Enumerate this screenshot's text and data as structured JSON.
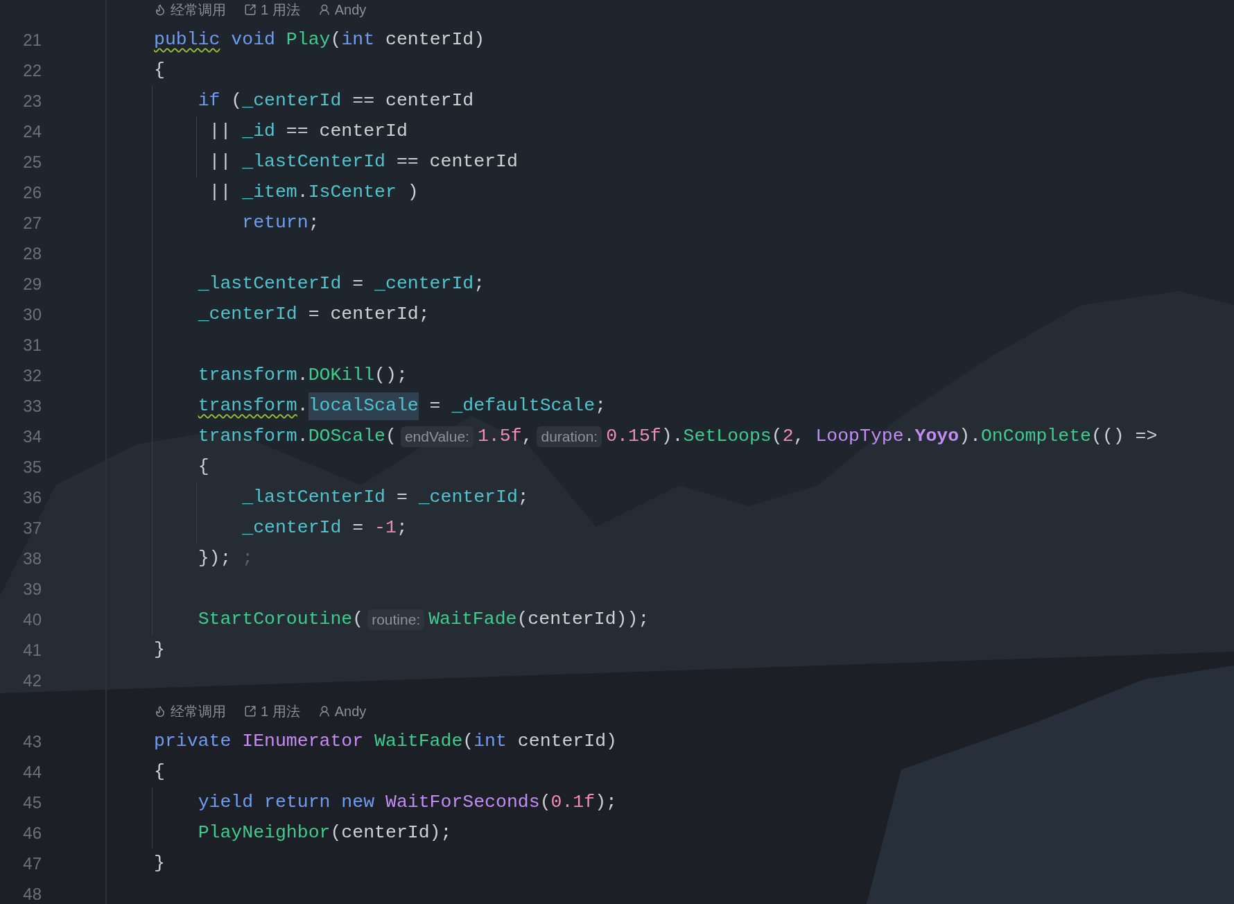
{
  "rows": [
    {
      "kind": "lens",
      "items": [
        {
          "kind": "frequent",
          "text": "经常调用"
        },
        {
          "kind": "usages",
          "text": "1 用法"
        },
        {
          "kind": "author",
          "text": "Andy"
        }
      ]
    },
    {
      "kind": "code",
      "number": "21",
      "tokens": [
        {
          "text": "public",
          "kind": "kw",
          "warning": true
        },
        {
          "text": " void",
          "kind": "kw"
        },
        {
          "text": " Play",
          "kind": "fn"
        },
        {
          "text": "(",
          "kind": "p"
        },
        {
          "text": "int",
          "kind": "kw"
        },
        {
          "text": " centerId)",
          "kind": "p"
        }
      ]
    },
    {
      "kind": "code",
      "number": "22",
      "tokens": [
        {
          "text": "{",
          "kind": "p"
        }
      ]
    },
    {
      "kind": "code",
      "number": "23",
      "outer_guide": true,
      "tokens": [
        {
          "text": "    if",
          "kind": "kw"
        },
        {
          "text": " (",
          "kind": "p"
        },
        {
          "text": "_centerId",
          "kind": "field"
        },
        {
          "text": " == centerId",
          "kind": "p"
        }
      ]
    },
    {
      "kind": "code",
      "number": "24",
      "outer_guide": true,
      "inner_guide": true,
      "tokens": [
        {
          "text": "     ||",
          "kind": "p"
        },
        {
          "text": " _id",
          "kind": "field"
        },
        {
          "text": " == centerId",
          "kind": "p"
        }
      ]
    },
    {
      "kind": "code",
      "number": "25",
      "outer_guide": true,
      "inner_guide": true,
      "tokens": [
        {
          "text": "     ||",
          "kind": "p"
        },
        {
          "text": " _lastCenterId",
          "kind": "field"
        },
        {
          "text": " == centerId",
          "kind": "p"
        }
      ]
    },
    {
      "kind": "code",
      "number": "26",
      "outer_guide": true,
      "tokens": [
        {
          "text": "     ||",
          "kind": "p"
        },
        {
          "text": " _item",
          "kind": "field"
        },
        {
          "text": ".",
          "kind": "p"
        },
        {
          "text": "IsCenter",
          "kind": "field"
        },
        {
          "text": " )",
          "kind": "p"
        }
      ]
    },
    {
      "kind": "code",
      "number": "27",
      "outer_guide": true,
      "tokens": [
        {
          "text": "        return",
          "kind": "kw"
        },
        {
          "text": ";",
          "kind": "p"
        }
      ]
    },
    {
      "kind": "code",
      "number": "28",
      "outer_guide": true
    },
    {
      "kind": "code",
      "number": "29",
      "outer_guide": true,
      "tokens": [
        {
          "text": "    _lastCenterId",
          "kind": "field"
        },
        {
          "text": " =",
          "kind": "p"
        },
        {
          "text": " _centerId",
          "kind": "field"
        },
        {
          "text": ";",
          "kind": "p"
        }
      ]
    },
    {
      "kind": "code",
      "number": "30",
      "outer_guide": true,
      "tokens": [
        {
          "text": "    _centerId",
          "kind": "field"
        },
        {
          "text": " = centerId;",
          "kind": "p"
        }
      ]
    },
    {
      "kind": "code",
      "number": "31",
      "outer_guide": true
    },
    {
      "kind": "code",
      "number": "32",
      "outer_guide": true,
      "tokens": [
        {
          "text": "    transform",
          "kind": "field"
        },
        {
          "text": ".",
          "kind": "p"
        },
        {
          "text": "DOKill",
          "kind": "fn"
        },
        {
          "text": "();",
          "kind": "p"
        }
      ]
    },
    {
      "kind": "code",
      "number": "33",
      "outer_guide": true,
      "tokens": [
        {
          "text": "    transform",
          "kind": "field",
          "warning": true
        },
        {
          "text": ".",
          "kind": "p"
        },
        {
          "text": "localScale",
          "kind": "field",
          "highlighted": true
        },
        {
          "text": " =",
          "kind": "p"
        },
        {
          "text": " _defaultScale",
          "kind": "field"
        },
        {
          "text": ";",
          "kind": "p"
        }
      ]
    },
    {
      "kind": "code",
      "number": "34",
      "outer_guide": true,
      "tokens": [
        {
          "text": "    transform",
          "kind": "field"
        },
        {
          "text": ".",
          "kind": "p"
        },
        {
          "text": "DOScale",
          "kind": "fn"
        },
        {
          "text": "(",
          "kind": "p"
        },
        {
          "text": "endValue:",
          "kind": "hint"
        },
        {
          "text": "1.5f",
          "kind": "num"
        },
        {
          "text": ",",
          "kind": "p"
        },
        {
          "text": "duration:",
          "kind": "hint"
        },
        {
          "text": "0.15f",
          "kind": "num"
        },
        {
          "text": ").",
          "kind": "p"
        },
        {
          "text": "SetLoops",
          "kind": "fn"
        },
        {
          "text": "(",
          "kind": "p"
        },
        {
          "text": "2",
          "kind": "num"
        },
        {
          "text": ",",
          "kind": "p"
        },
        {
          "text": " LoopType",
          "kind": "type"
        },
        {
          "text": ".",
          "kind": "p"
        },
        {
          "text": "Yoyo",
          "kind": "typebold"
        },
        {
          "text": ").",
          "kind": "p"
        },
        {
          "text": "OnComplete",
          "kind": "fn"
        },
        {
          "text": "(() =>",
          "kind": "p"
        }
      ]
    },
    {
      "kind": "code",
      "number": "35",
      "outer_guide": true,
      "tokens": [
        {
          "text": "    {",
          "kind": "p"
        }
      ]
    },
    {
      "kind": "code",
      "number": "36",
      "outer_guide": true,
      "inner_guide": true,
      "tokens": [
        {
          "text": "        _lastCenterId",
          "kind": "field"
        },
        {
          "text": " =",
          "kind": "p"
        },
        {
          "text": " _centerId",
          "kind": "field"
        },
        {
          "text": ";",
          "kind": "p"
        }
      ]
    },
    {
      "kind": "code",
      "number": "37",
      "outer_guide": true,
      "inner_guide": true,
      "tokens": [
        {
          "text": "        _centerId",
          "kind": "field"
        },
        {
          "text": " =",
          "kind": "p"
        },
        {
          "text": " -1",
          "kind": "num"
        },
        {
          "text": ";",
          "kind": "p"
        }
      ]
    },
    {
      "kind": "code",
      "number": "38",
      "outer_guide": true,
      "tokens": [
        {
          "text": "    });",
          "kind": "p"
        },
        {
          "text": " ;",
          "kind": "muted"
        }
      ]
    },
    {
      "kind": "code",
      "number": "39",
      "outer_guide": true
    },
    {
      "kind": "code",
      "number": "40",
      "outer_guide": true,
      "tokens": [
        {
          "text": "    StartCoroutine",
          "kind": "fn"
        },
        {
          "text": "(",
          "kind": "p"
        },
        {
          "text": "routine:",
          "kind": "hint"
        },
        {
          "text": "WaitFade",
          "kind": "fn"
        },
        {
          "text": "(centerId));",
          "kind": "p"
        }
      ]
    },
    {
      "kind": "code",
      "number": "41",
      "tokens": [
        {
          "text": "}",
          "kind": "p"
        }
      ]
    },
    {
      "kind": "code",
      "number": "42"
    },
    {
      "kind": "lens",
      "items": [
        {
          "kind": "frequent",
          "text": "经常调用"
        },
        {
          "kind": "usages",
          "text": "1 用法"
        },
        {
          "kind": "author",
          "text": "Andy"
        }
      ]
    },
    {
      "kind": "code",
      "number": "43",
      "tokens": [
        {
          "text": "private",
          "kind": "kw"
        },
        {
          "text": " IEnumerator",
          "kind": "type"
        },
        {
          "text": " WaitFade",
          "kind": "fn"
        },
        {
          "text": "(",
          "kind": "p"
        },
        {
          "text": "int",
          "kind": "kw"
        },
        {
          "text": " centerId)",
          "kind": "p"
        }
      ]
    },
    {
      "kind": "code",
      "number": "44",
      "tokens": [
        {
          "text": "{",
          "kind": "p"
        }
      ]
    },
    {
      "kind": "code",
      "number": "45",
      "outer_guide": true,
      "tokens": [
        {
          "text": "    yield return new",
          "kind": "kw"
        },
        {
          "text": " WaitForSeconds",
          "kind": "type"
        },
        {
          "text": "(",
          "kind": "p"
        },
        {
          "text": "0.1f",
          "kind": "num"
        },
        {
          "text": ");",
          "kind": "p"
        }
      ]
    },
    {
      "kind": "code",
      "number": "46",
      "outer_guide": true,
      "tokens": [
        {
          "text": "    PlayNeighbor",
          "kind": "fn"
        },
        {
          "text": "(centerId);",
          "kind": "p"
        }
      ]
    },
    {
      "kind": "code",
      "number": "47",
      "tokens": [
        {
          "text": "}",
          "kind": "p"
        }
      ]
    },
    {
      "kind": "code",
      "number": "48"
    }
  ]
}
